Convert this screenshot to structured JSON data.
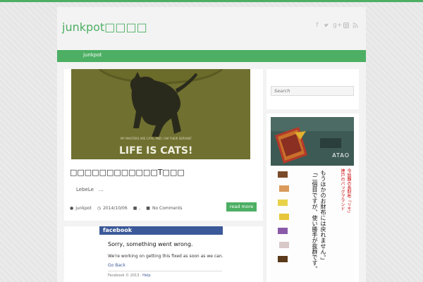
{
  "site": {
    "title": "junkpot□□□□",
    "social_icons": [
      "facebook-icon",
      "twitter-icon",
      "google-plus-icon",
      "instagram-icon",
      "rss-icon"
    ]
  },
  "nav": {
    "items": [
      {
        "label": "junkpot"
      }
    ]
  },
  "post": {
    "image": {
      "caption_top": "MY MASTERS ARE CATS, AND I AM THEIR SERVANT.",
      "caption": "LIFE IS CATS!"
    },
    "title": "□□□□□□□□□□□□T□□□",
    "excerpt": "LebeLe　…",
    "meta": {
      "author": "junkpot",
      "date": "2014/10/06",
      "category": ",",
      "comments": "No Comments"
    },
    "read_more": "read more"
  },
  "facebook": {
    "logo": "facebook",
    "error_title": "Sorry, something went wrong.",
    "error_sub": "We're working on getting this fixed as soon as we can.",
    "back_link": "Go Back",
    "footer_prefix": "Facebook © 2013 · ",
    "footer_help": "Help"
  },
  "sidebar": {
    "search_placeholder": "Search",
    "ad": {
      "brand": "ATAO",
      "headline_col1": "「二個目ですが、使い勝手が抜群です。",
      "headline_col2": "もうほかのお財布には戻れません。」",
      "red_col1": "神戸のバッグブランド",
      "red_col2": "今話題の長財布『リモ』"
    }
  },
  "colors": {
    "accent": "#4caf63",
    "facebook": "#3b5998",
    "shirt": "#6b6b2a"
  }
}
